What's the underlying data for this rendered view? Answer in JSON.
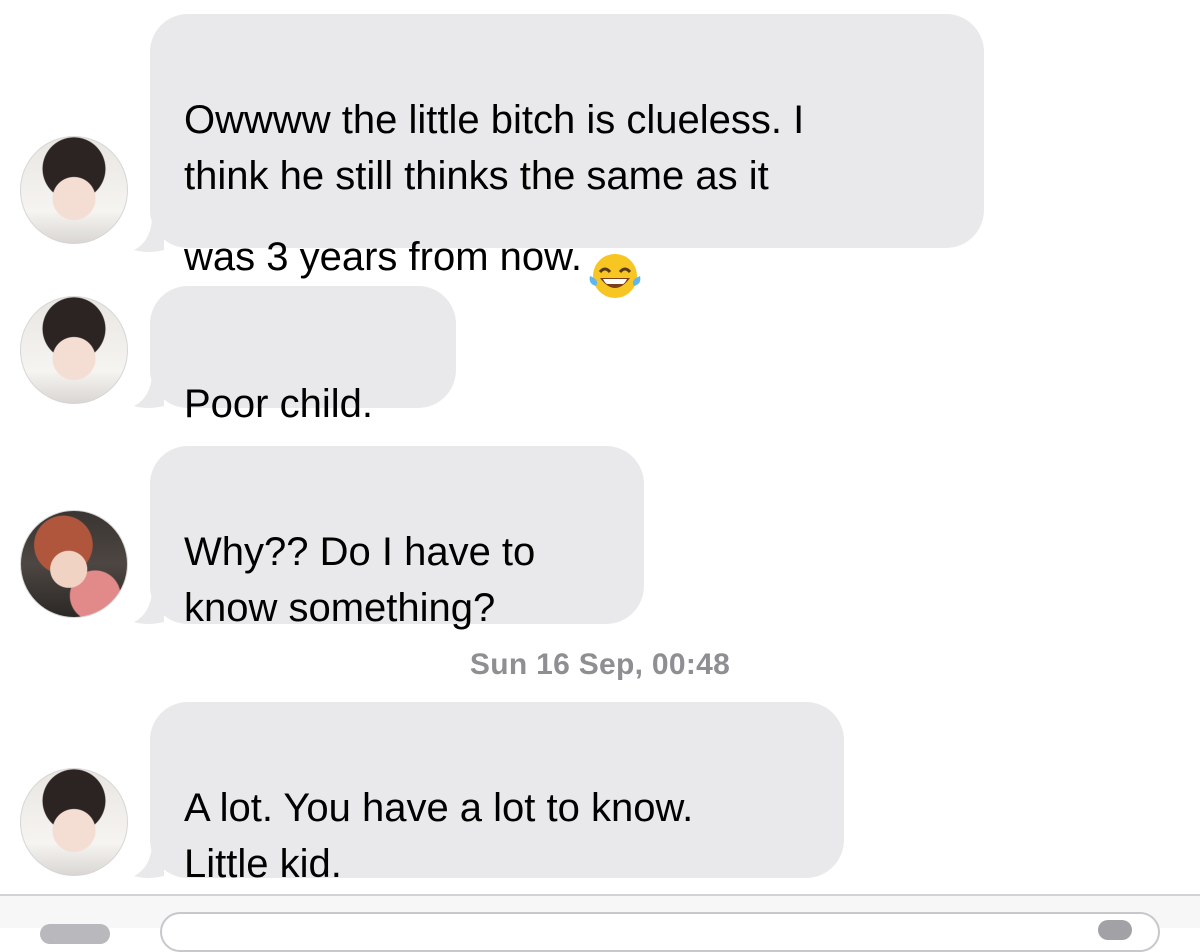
{
  "conversation": {
    "messages": [
      {
        "text": "Owwww the little bitch is clueless. I\nthink he still thinks the same as it\nwas 3 years from now.",
        "emoji": "face-with-tears-of-joy"
      },
      {
        "text": "Poor child."
      },
      {
        "text": "Why?? Do I have to\nknow something?"
      },
      {
        "text": "A lot. You have a lot to know.\nLittle kid."
      }
    ],
    "timestamp": "Sun 16 Sep, 00:48"
  },
  "colors": {
    "bubble_incoming": "#e9e9eb",
    "timestamp_text": "#8e8e93",
    "background": "#ffffff"
  }
}
